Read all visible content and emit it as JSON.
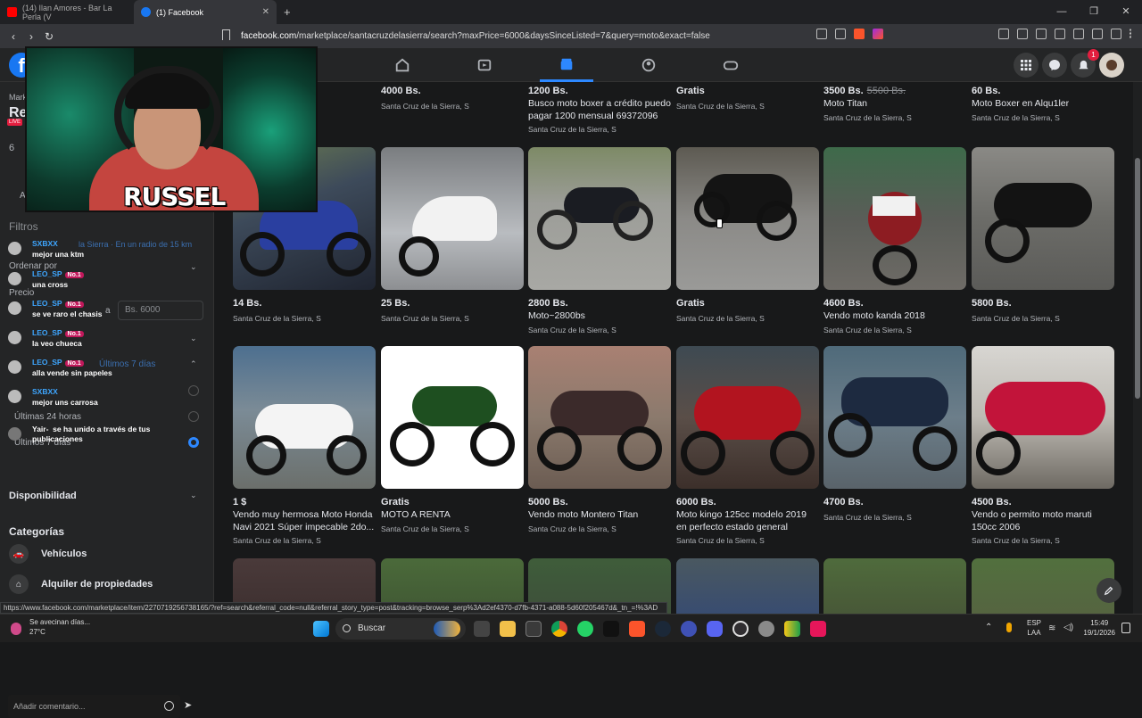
{
  "browser": {
    "tabs": [
      {
        "label": "(14) Ilan Amores - Bar La Perla (V",
        "active": false
      },
      {
        "label": "(1) Facebook",
        "active": true
      }
    ],
    "url_domain": "facebook.com",
    "url_path": "/marketplace/santacruzdelasierra/search?maxPrice=6000&daysSinceListed=7&query=moto&exact=false",
    "notif_count": "1",
    "status_url": "https://www.facebook.com/marketplace/item/2270719256738165/?ref=search&referral_code=null&referral_story_type=post&tracking=browse_serp%3Ad2ef4370-d7fb-4371-a088-5d60f205467d&_tn_=!%3AD"
  },
  "overlay": {
    "streamer_name": "RUSSEL"
  },
  "sidebar": {
    "marketplace_fragment": "Mark",
    "search_fragment": "Re",
    "live": "LIVE",
    "filters_heading": "Filtros",
    "location_text": "la Sierra · En un radio de 15 km",
    "sort_label": "Ordenar por",
    "price_label": "Precio",
    "price_a": "a",
    "price_max_placeholder": "Bs. 6000",
    "date_option_7": "Últimos 7 días",
    "date_option_24": "Últimas 24 horas",
    "date_option_30": "Últimos 7 días",
    "availability": "Disponibilidad",
    "categories_heading": "Categorías",
    "cat_vehicles": "Vehículos",
    "cat_rentals": "Alquiler de propiedades",
    "count_fragment": "6",
    "a_fragment": "A"
  },
  "chat": {
    "messages": [
      {
        "user": "SXBXX",
        "text": "mejor una ktm",
        "badge": ""
      },
      {
        "user": "LEO_SP",
        "text": "una cross",
        "badge": "No.1"
      },
      {
        "user": "LEO_SP",
        "text": "se ve raro el chasis",
        "badge": "No.1"
      },
      {
        "user": "LEO_SP",
        "text": "la veo chueca",
        "badge": "No.1"
      },
      {
        "user": "LEO_SP",
        "text": "alla vende sin papeles",
        "badge": "No.1"
      },
      {
        "user": "SXBXX",
        "text": "mejor uns carrosa",
        "badge": ""
      },
      {
        "user": "Yair-",
        "text": "se ha unido a través de tus publicaciones",
        "badge": ""
      }
    ],
    "input_placeholder": "Añadir comentario..."
  },
  "listings": {
    "row0": [
      {
        "price": "",
        "old_price": "",
        "title": "",
        "location": ""
      },
      {
        "price": "4000 Bs.",
        "old_price": "",
        "title": "",
        "location": "Santa Cruz de la Sierra, S"
      },
      {
        "price": "1200 Bs.",
        "old_price": "",
        "title": "Busco moto boxer a crédito puedo pagar 1200 mensual 69372096",
        "location": "Santa Cruz de la Sierra, S"
      },
      {
        "price": "Gratis",
        "old_price": "",
        "title": "",
        "location": "Santa Cruz de la Sierra, S"
      },
      {
        "price": "3500 Bs.",
        "old_price": "5500 Bs.",
        "title": "Moto Titan",
        "location": "Santa Cruz de la Sierra, S"
      },
      {
        "price": "60 Bs.",
        "old_price": "",
        "title": "Moto Boxer en Alqu1ler",
        "location": "Santa Cruz de la Sierra, S"
      }
    ],
    "row1": [
      {
        "price": "14 Bs.",
        "title": "",
        "location": "Santa Cruz de la Sierra, S"
      },
      {
        "price": "25 Bs.",
        "title": "",
        "location": "Santa Cruz de la Sierra, S"
      },
      {
        "price": "2800 Bs.",
        "title": "Moto~2800bs",
        "location": "Santa Cruz de la Sierra, S"
      },
      {
        "price": "Gratis",
        "title": "",
        "location": "Santa Cruz de la Sierra, S"
      },
      {
        "price": "4600 Bs.",
        "title": "Vendo moto kanda 2018",
        "location": "Santa Cruz de la Sierra, S"
      },
      {
        "price": "5800 Bs.",
        "title": "",
        "location": "Santa Cruz de la Sierra, S"
      }
    ],
    "row2": [
      {
        "price": "1 $",
        "title": "Vendo muy hermosa Moto Honda Navi 2021 Súper impecable 2do...",
        "location": "Santa Cruz de la Sierra, S"
      },
      {
        "price": "Gratis",
        "title": "MOTO A RENTA",
        "location": "Santa Cruz de la Sierra, S"
      },
      {
        "price": "5000 Bs.",
        "title": "Vendo moto Montero Titan",
        "location": "Santa Cruz de la Sierra, S"
      },
      {
        "price": "6000 Bs.",
        "title": "Moto kingo 125cc modelo 2019 en perfecto estado general",
        "location": "Santa Cruz de la Sierra, S"
      },
      {
        "price": "4700 Bs.",
        "title": "",
        "location": "Santa Cruz de la Sierra, S"
      },
      {
        "price": "4500 Bs.",
        "title": "Vendo o permito moto maruti 150cc 2006",
        "location": "Santa Cruz de la Sierra, S"
      }
    ]
  },
  "taskbar": {
    "weather_text": "Se avecinan días...",
    "temperature": "27°C",
    "search_label": "Buscar",
    "lang1": "ESP",
    "lang2": "LAA",
    "time": "15:49",
    "date": "19/1/2026"
  },
  "colors": {
    "accent": "#2d88ff",
    "fb_blue": "#1877f2",
    "background": "#18191a"
  }
}
